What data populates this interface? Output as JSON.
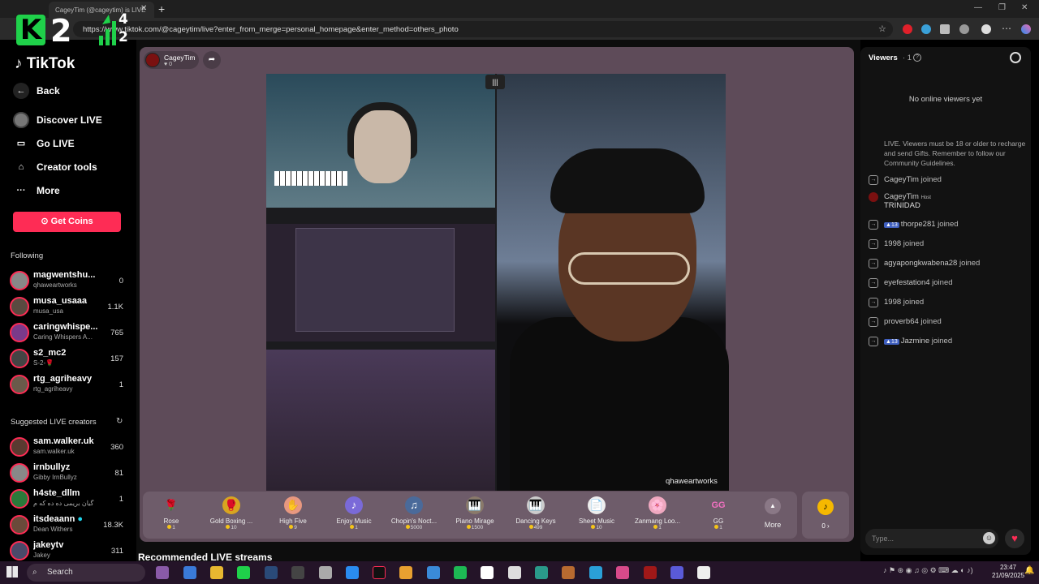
{
  "browser": {
    "tab_title": "CageyTim (@cageytim) is LIVE",
    "url": "https://www.tiktok.com/@cageytim/live?enter_from_merge=personal_homepage&enter_method=others_photo"
  },
  "overlay": {
    "logo_letter": "K",
    "logo_number": "2",
    "score_top": "4",
    "score_bottom": "2"
  },
  "sidebar": {
    "brand": "TikTok",
    "nav": [
      {
        "label": "Back",
        "icon": "back-arrow-icon"
      },
      {
        "label": "Discover LIVE",
        "icon": "avatar-icon"
      },
      {
        "label": "Go LIVE",
        "icon": "camera-icon"
      },
      {
        "label": "Creator tools",
        "icon": "lightbulb-icon"
      },
      {
        "label": "More",
        "icon": "ellipsis-icon"
      }
    ],
    "get_coins": "Get Coins",
    "following_title": "Following",
    "following": [
      {
        "name": "magwentshu...",
        "sub": "qhaweartworks",
        "count": "0"
      },
      {
        "name": "musa_usaaa",
        "sub": "musa_usa",
        "count": "1.1K"
      },
      {
        "name": "caringwhispe...",
        "sub": "Caring Whispers A...",
        "count": "765"
      },
      {
        "name": "s2_mc2",
        "sub": "S-2-🌹",
        "count": "157"
      },
      {
        "name": "rtg_agriheavy",
        "sub": "rtg_agriheavy",
        "count": "1"
      }
    ],
    "suggested_title": "Suggested LIVE creators",
    "suggested": [
      {
        "name": "sam.walker.uk",
        "sub": "sam.walker.uk",
        "count": "360"
      },
      {
        "name": "irnbullyz",
        "sub": "Gibby IrnBullyz",
        "count": "81"
      },
      {
        "name": "h4ste_dllm",
        "sub": "گیان بریمی ده ده که م",
        "count": "1"
      },
      {
        "name": "itsdeaann",
        "sub": "Dean Withers",
        "count": "18.3K"
      },
      {
        "name": "jakeytv",
        "sub": "Jakey",
        "count": "311"
      }
    ]
  },
  "stream": {
    "host_name": "CageyTim",
    "host_likes": "0",
    "video_credit": "qhaweartworks",
    "recommended_title": "Recommended LIVE streams"
  },
  "gifts": [
    {
      "name": "Rose",
      "price": "1",
      "icon": "🌹"
    },
    {
      "name": "Gold Boxing ...",
      "price": "10",
      "icon": "🥊"
    },
    {
      "name": "High Five",
      "price": "9",
      "icon": "✋"
    },
    {
      "name": "Enjoy Music",
      "price": "1",
      "icon": "♪"
    },
    {
      "name": "Chopin's Noct...",
      "price": "5000",
      "icon": "♫"
    },
    {
      "name": "Piano Mirage",
      "price": "1500",
      "icon": "🎹"
    },
    {
      "name": "Dancing Keys",
      "price": "499",
      "icon": "🎹"
    },
    {
      "name": "Sheet Music",
      "price": "10",
      "icon": "📄"
    },
    {
      "name": "Zanmang Loo...",
      "price": "1",
      "icon": "🌸"
    },
    {
      "name": "GG",
      "price": "1",
      "icon": "GG"
    }
  ],
  "gift_more": "More",
  "coin_balance": "0 ›",
  "viewers": {
    "title": "Viewers",
    "count": "· 1",
    "empty": "No online viewers yet",
    "notice": "LIVE. Viewers must be 18 or older to recharge and send Gifts. Remember to follow our Community Guidelines.",
    "chat": [
      {
        "user": "CageyTim",
        "text": "joined",
        "level": ""
      },
      {
        "user": "CageyTim",
        "text": "TRINIDAD",
        "level": "",
        "host": "Host"
      },
      {
        "user": "thorpe281",
        "text": "joined",
        "level": "13"
      },
      {
        "user": "1998",
        "text": "joined",
        "level": ""
      },
      {
        "user": "agyapongkwabena28",
        "text": "joined",
        "level": ""
      },
      {
        "user": "eyefestation4",
        "text": "joined",
        "level": ""
      },
      {
        "user": "1998",
        "text": "joined",
        "level": ""
      },
      {
        "user": "proverb64",
        "text": "joined",
        "level": ""
      },
      {
        "user": "Jazmine",
        "text": "joined",
        "level": "13"
      }
    ],
    "input_placeholder": "Type..."
  },
  "taskbar": {
    "search": "Search",
    "time": "23:47",
    "date": "21/09/2025"
  },
  "colors": {
    "accent": "#fe2c55",
    "panel": "#5e4b59",
    "coin": "#f5c518"
  }
}
